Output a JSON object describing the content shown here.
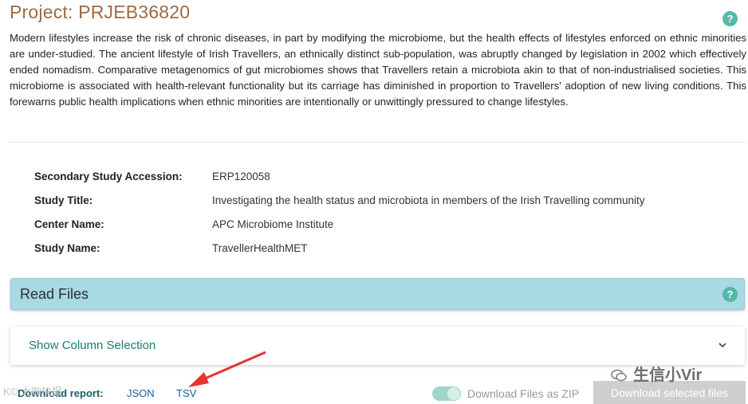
{
  "project": {
    "title": "Project: PRJEB36820",
    "description": "Modern lifestyles increase the risk of chronic diseases, in part by modifying the microbiome, but the health effects of lifestyles enforced on ethnic minorities are under-studied. The ancient lifestyle of Irish Travellers, an ethnically distinct sub-population, was abruptly changed by legislation in 2002 which effectively ended nomadism. Comparative metagenomics of gut microbiomes shows that Travellers retain a microbiota akin to that of non-industrialised societies. This microbiome is associated with health-relevant functionality but its carriage has diminished in proportion to Travellers' adoption of new living conditions. This forewarns public health implications when ethnic minorities are intentionally or unwittingly pressured to change lifestyles."
  },
  "help_icon": "?",
  "metadata": [
    {
      "label": "Secondary Study Accession:",
      "value": "ERP120058"
    },
    {
      "label": "Study Title:",
      "value": "Investigating the health status and microbiota in members of the Irish Travelling community"
    },
    {
      "label": "Center Name:",
      "value": "APC Microbiome Institute"
    },
    {
      "label": "Study Name:",
      "value": "TravellerHealthMET"
    }
  ],
  "read_files": {
    "label": "Read Files",
    "column_selection": "Show Column Selection"
  },
  "download": {
    "label": "Download report:",
    "json": "JSON",
    "tsv": "TSV",
    "zip_label": "Download Files as ZIP",
    "zip_enabled": true,
    "selected_button": "Download selected files"
  },
  "watermarks": {
    "wechat": "生信小Vir",
    "left": "K© 大咖快报"
  },
  "colors": {
    "title": "#9c6b43",
    "accent": "#57b7a8",
    "read_files_bar": "#a9d9e3",
    "link": "#1a5b9c"
  }
}
